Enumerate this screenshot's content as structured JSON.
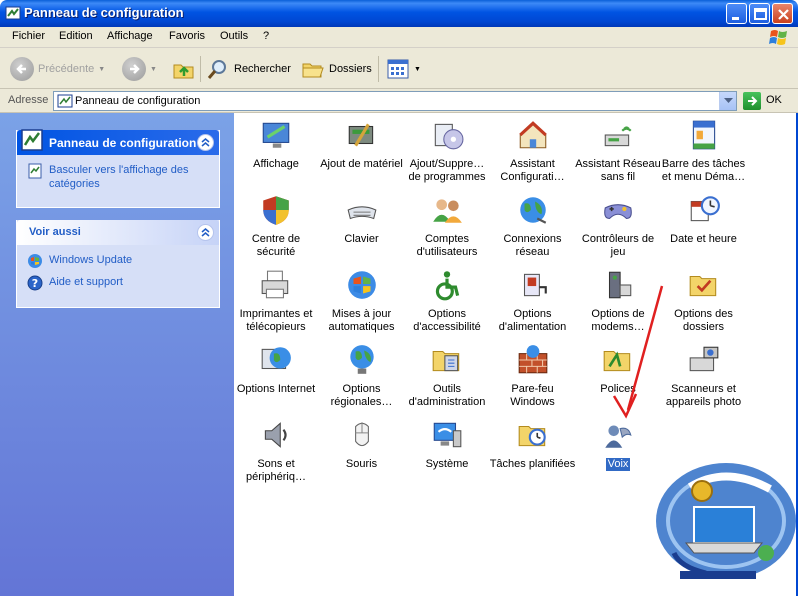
{
  "window": {
    "title": "Panneau de configuration"
  },
  "menu": [
    "Fichier",
    "Edition",
    "Affichage",
    "Favoris",
    "Outils",
    "?"
  ],
  "toolbar": {
    "back": "Précédente",
    "search": "Rechercher",
    "folders": "Dossiers"
  },
  "address": {
    "label": "Adresse",
    "value": "Panneau de configuration",
    "go": "OK"
  },
  "left_pane": {
    "cp_title": "Panneau de configuration",
    "switch_view": "Basculer vers l'affichage des catégories",
    "see_also_title": "Voir aussi",
    "links": [
      "Windows Update",
      "Aide et support"
    ]
  },
  "items": [
    {
      "label": "Affichage",
      "icon": "display-icon"
    },
    {
      "label": "Ajout de matériel",
      "icon": "add-hardware-icon"
    },
    {
      "label": "Ajout/Suppre… de programmes",
      "icon": "add-remove-programs-icon"
    },
    {
      "label": "Assistant Configurati…",
      "icon": "network-setup-icon"
    },
    {
      "label": "Assistant Réseau sans fil",
      "icon": "wireless-network-icon"
    },
    {
      "label": "Barre des tâches et menu Déma…",
      "icon": "taskbar-icon"
    },
    {
      "label": "Centre de sécurité",
      "icon": "security-center-icon"
    },
    {
      "label": "Clavier",
      "icon": "keyboard-icon"
    },
    {
      "label": "Comptes d'utilisateurs",
      "icon": "user-accounts-icon"
    },
    {
      "label": "Connexions réseau",
      "icon": "network-connections-icon"
    },
    {
      "label": "Contrôleurs de jeu",
      "icon": "game-controllers-icon"
    },
    {
      "label": "Date et heure",
      "icon": "date-time-icon"
    },
    {
      "label": "Imprimantes et télécopieurs",
      "icon": "printers-icon"
    },
    {
      "label": "Mises à jour automatiques",
      "icon": "automatic-updates-icon"
    },
    {
      "label": "Options d'accessibilité",
      "icon": "accessibility-icon"
    },
    {
      "label": "Options d'alimentation",
      "icon": "power-options-icon"
    },
    {
      "label": "Options de modems…",
      "icon": "modem-icon"
    },
    {
      "label": "Options des dossiers",
      "icon": "folder-options-icon"
    },
    {
      "label": "Options Internet",
      "icon": "internet-options-icon"
    },
    {
      "label": "Options régionales…",
      "icon": "regional-options-icon"
    },
    {
      "label": "Outils d'administration",
      "icon": "admin-tools-icon"
    },
    {
      "label": "Pare-feu Windows",
      "icon": "firewall-icon"
    },
    {
      "label": "Polices",
      "icon": "fonts-icon"
    },
    {
      "label": "Scanneurs et appareils photo",
      "icon": "scanner-icon"
    },
    {
      "label": "Sons et périphériq…",
      "icon": "sounds-icon"
    },
    {
      "label": "Souris",
      "icon": "mouse-icon"
    },
    {
      "label": "Système",
      "icon": "system-icon"
    },
    {
      "label": "Tâches planifiées",
      "icon": "scheduled-tasks-icon"
    },
    {
      "label": "Voix",
      "icon": "speech-icon",
      "selected": true
    }
  ]
}
